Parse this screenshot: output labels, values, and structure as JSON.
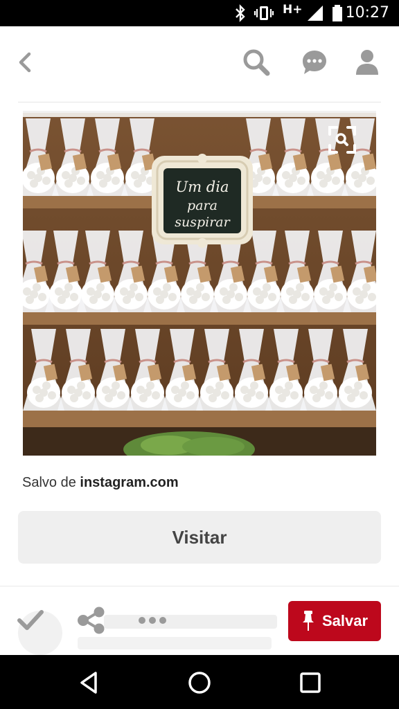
{
  "status_bar": {
    "time": "10:27",
    "network": "H+",
    "icons": [
      "bluetooth-icon",
      "vibrate-icon",
      "signal-icon",
      "battery-icon"
    ]
  },
  "top_bar": {
    "icons": [
      "back-arrow-icon",
      "search-icon",
      "chat-bubble-icon",
      "profile-icon"
    ]
  },
  "pin": {
    "image_sign_text": [
      "Um dia",
      "para",
      "suspirar"
    ],
    "visual_search_icon": "visual-search-icon"
  },
  "source": {
    "prefix": "Salvo de",
    "domain": "instagram.com"
  },
  "visit_button": {
    "label": "Visitar"
  },
  "actions": {
    "icons": [
      "checkmark-icon",
      "share-icon",
      "more-dots-icon",
      "pin-icon"
    ],
    "save_label": "Salvar",
    "accent_color": "#bd081c"
  },
  "nav_bar": {
    "icons": [
      "back-triangle-icon",
      "home-circle-icon",
      "recents-square-icon"
    ]
  }
}
